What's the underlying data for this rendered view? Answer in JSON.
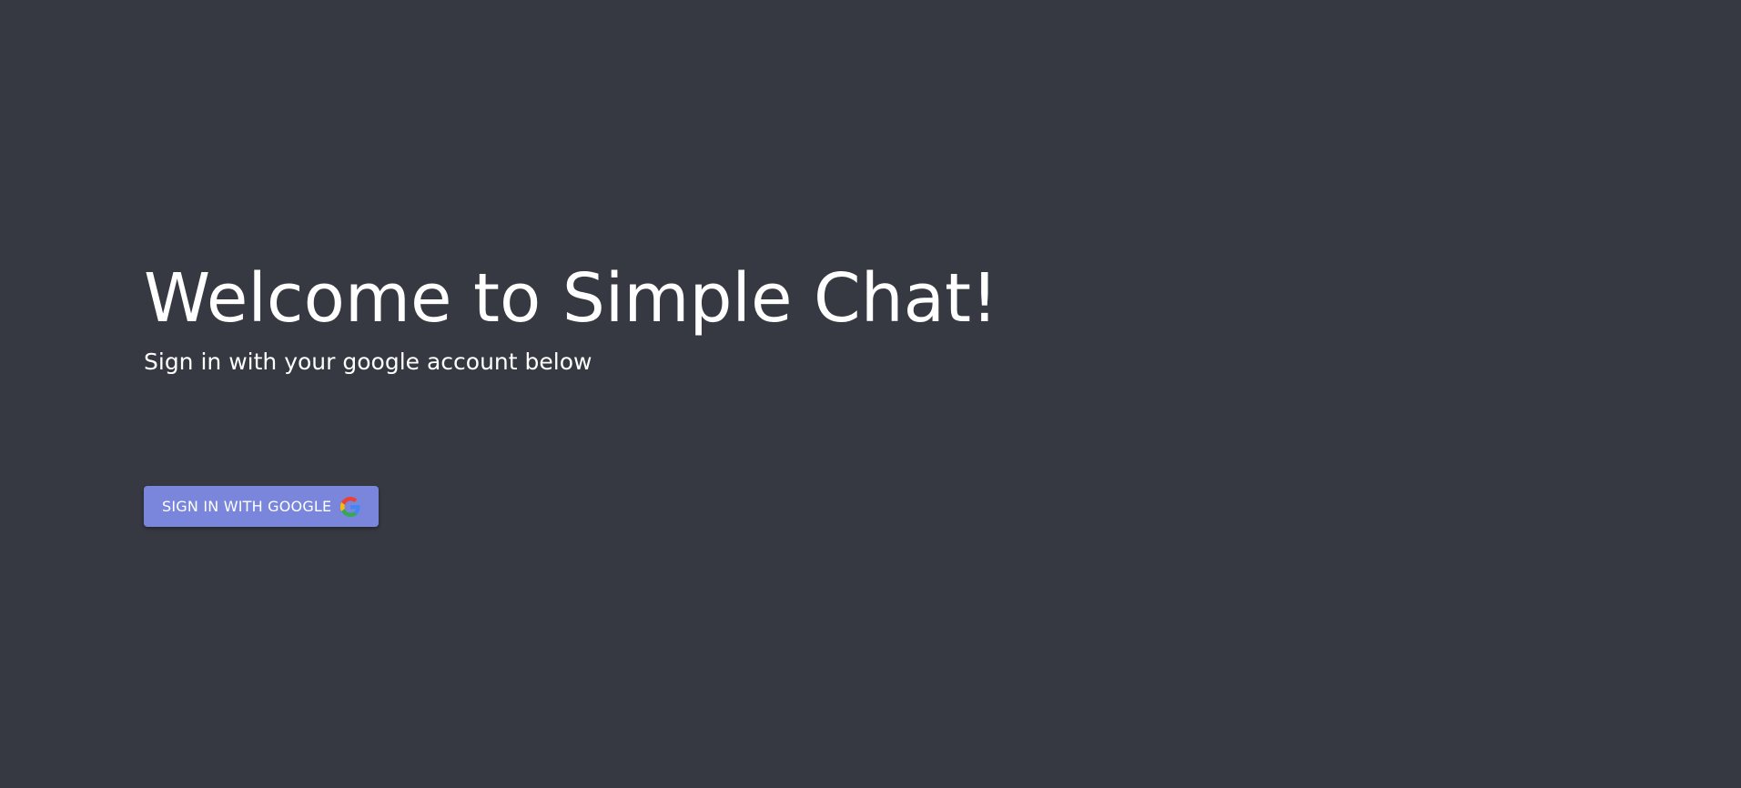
{
  "welcome": {
    "title": "Welcome to Simple Chat!",
    "subtitle": "Sign in with your google account below"
  },
  "signin": {
    "button_label": "SIGN IN WITH GOOGLE",
    "icon": "google-icon"
  },
  "colors": {
    "background": "#363941",
    "button": "#7986dc",
    "text": "#ffffff"
  }
}
